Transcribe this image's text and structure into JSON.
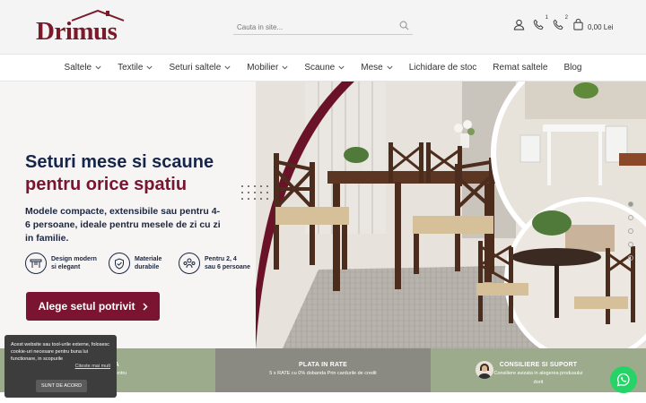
{
  "header": {
    "logo_text": "Drimus",
    "search_placeholder": "Cauta in site...",
    "calls_badge_1": "1",
    "calls_badge_2": "2",
    "cart_total": "0,00 Lei"
  },
  "nav": {
    "items": [
      {
        "label": "Saltele",
        "dropdown": true
      },
      {
        "label": "Textile",
        "dropdown": true
      },
      {
        "label": "Seturi saltele",
        "dropdown": true
      },
      {
        "label": "Mobilier",
        "dropdown": true
      },
      {
        "label": "Scaune",
        "dropdown": true
      },
      {
        "label": "Mese",
        "dropdown": true
      },
      {
        "label": "Lichidare de stoc",
        "dropdown": false
      },
      {
        "label": "Remat saltele",
        "dropdown": false
      },
      {
        "label": "Blog",
        "dropdown": false
      }
    ]
  },
  "hero": {
    "title_line1": "Seturi mese si scaune",
    "title_line2": "pentru orice spatiu",
    "subtitle": "Modele compacte, extensibile sau pentru 4-6 persoane, ideale pentru mesele de zi cu zi in familie.",
    "features": [
      {
        "icon": "table-icon",
        "text_line1": "Design modern",
        "text_line2": "si elegant"
      },
      {
        "icon": "shield-icon",
        "text_line1": "Materiale",
        "text_line2": "durabile"
      },
      {
        "icon": "people-icon",
        "text_line1": "Pentru 2, 4",
        "text_line2": "sau 6 persoane"
      }
    ],
    "cta_label": "Alege setul potrivit",
    "slides_count": 5,
    "active_slide": 0
  },
  "strip": {
    "c1_title": "ATUITA",
    "c1_desc": "te 1500 lei pentru",
    "c1_desc2": "R",
    "c2_title": "PLATA IN RATE",
    "c2_desc": "5 x RATE cu 0% dobanda Prin cardurile de credit",
    "c3_title": "CONSILIERE SI SUPORT",
    "c3_desc": "Consiliere avizata in alegerea produsului",
    "c3_desc2": "dorit"
  },
  "cookie": {
    "text": "Acest website sau tool-urile externe, folosesc cookie-uri necesare pentru buna lui functionare, in scopurile",
    "more_link": "Citeste mai mult",
    "accept_label": "SUNT DE ACORD"
  },
  "colors": {
    "brand": "#7a1430",
    "navy": "#16264a",
    "strip_green": "#9cab8c",
    "strip_gray": "#8a8a82",
    "whatsapp": "#25d366"
  }
}
